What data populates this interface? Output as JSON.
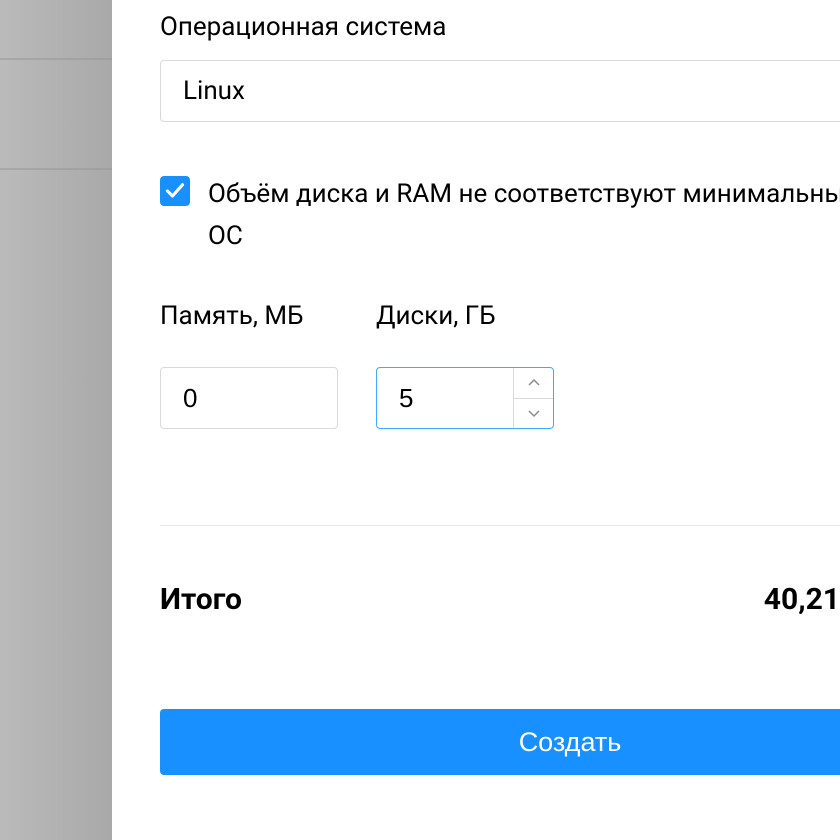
{
  "os_field": {
    "label": "Операционная система",
    "value": "Linux"
  },
  "warning_checkbox": {
    "checked": true,
    "label": "Объём диска и RAM не соответствуют минимальным требованиям ОС"
  },
  "memory_field": {
    "label": "Память, МБ",
    "value": "0"
  },
  "disks_field": {
    "label": "Диски, ГБ",
    "value": "5"
  },
  "total": {
    "label": "Итого",
    "value": "40,21"
  },
  "create_button": {
    "label": "Создать"
  }
}
